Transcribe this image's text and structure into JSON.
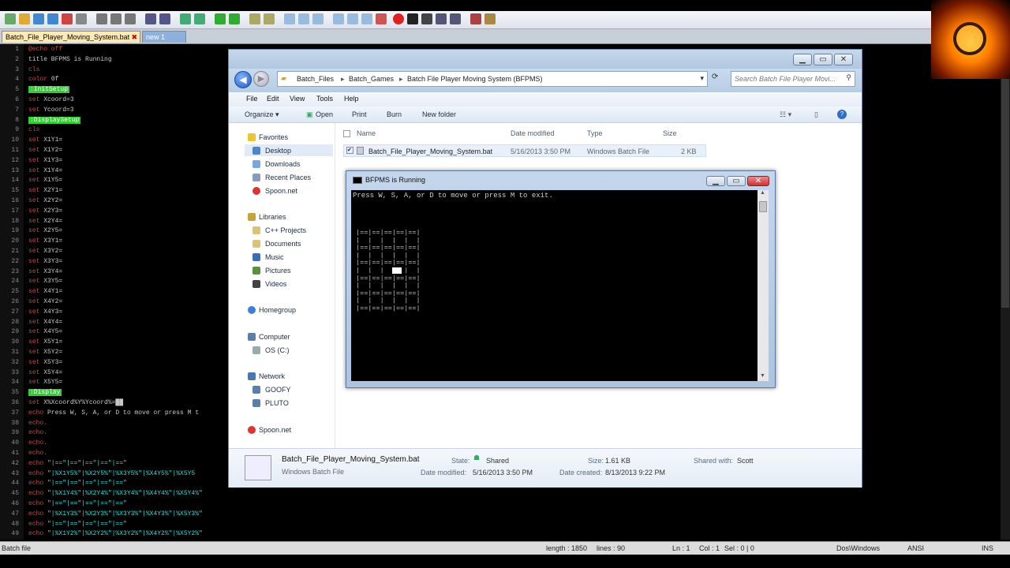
{
  "npp": {
    "tabs": [
      "Batch_File_Player_Moving_System.bat",
      "new 1"
    ],
    "lines": [
      {
        "n": "1",
        "parts": [
          [
            "kw",
            "@echo off"
          ]
        ]
      },
      {
        "n": "2",
        "parts": [
          [
            "",
            "title BFPMS is Running"
          ]
        ]
      },
      {
        "n": "3",
        "parts": [
          [
            "kw",
            "cls"
          ]
        ]
      },
      {
        "n": "4",
        "parts": [
          [
            "kw",
            "color"
          ],
          [
            "",
            " 0f"
          ]
        ]
      },
      {
        "n": "5",
        "parts": [
          [
            "lbl",
            ":InitSetup"
          ]
        ]
      },
      {
        "n": "6",
        "parts": [
          [
            "kw",
            "set"
          ],
          [
            "",
            " Xcoord=3"
          ]
        ]
      },
      {
        "n": "7",
        "parts": [
          [
            "kw",
            "set"
          ],
          [
            "",
            " Ycoord=3"
          ]
        ]
      },
      {
        "n": "8",
        "parts": [
          [
            "lbl",
            ":DisplaySetup"
          ]
        ]
      },
      {
        "n": "9",
        "parts": [
          [
            "kw",
            "cls"
          ]
        ]
      },
      {
        "n": "10",
        "parts": [
          [
            "kw",
            "set"
          ],
          [
            "",
            " X1Y1="
          ]
        ]
      },
      {
        "n": "11",
        "parts": [
          [
            "kw",
            "set"
          ],
          [
            "",
            " X1Y2="
          ]
        ]
      },
      {
        "n": "12",
        "parts": [
          [
            "kw",
            "set"
          ],
          [
            "",
            " X1Y3="
          ]
        ]
      },
      {
        "n": "13",
        "parts": [
          [
            "kw",
            "set"
          ],
          [
            "",
            " X1Y4="
          ]
        ]
      },
      {
        "n": "14",
        "parts": [
          [
            "kw",
            "set"
          ],
          [
            "",
            " X1Y5="
          ]
        ]
      },
      {
        "n": "15",
        "parts": [
          [
            "kw",
            "set"
          ],
          [
            "",
            " X2Y1="
          ]
        ]
      },
      {
        "n": "16",
        "parts": [
          [
            "kw",
            "set"
          ],
          [
            "",
            " X2Y2="
          ]
        ]
      },
      {
        "n": "17",
        "parts": [
          [
            "kw",
            "set"
          ],
          [
            "",
            " X2Y3="
          ]
        ]
      },
      {
        "n": "18",
        "parts": [
          [
            "kw",
            "set"
          ],
          [
            "",
            " X2Y4="
          ]
        ]
      },
      {
        "n": "19",
        "parts": [
          [
            "kw",
            "set"
          ],
          [
            "",
            " X2Y5="
          ]
        ]
      },
      {
        "n": "20",
        "parts": [
          [
            "kw",
            "set"
          ],
          [
            "",
            " X3Y1="
          ]
        ]
      },
      {
        "n": "21",
        "parts": [
          [
            "kw",
            "set"
          ],
          [
            "",
            " X3Y2="
          ]
        ]
      },
      {
        "n": "22",
        "parts": [
          [
            "kw",
            "set"
          ],
          [
            "",
            " X3Y3="
          ]
        ]
      },
      {
        "n": "23",
        "parts": [
          [
            "kw",
            "set"
          ],
          [
            "",
            " X3Y4="
          ]
        ]
      },
      {
        "n": "24",
        "parts": [
          [
            "kw",
            "set"
          ],
          [
            "",
            " X3Y5="
          ]
        ]
      },
      {
        "n": "25",
        "parts": [
          [
            "kw",
            "set"
          ],
          [
            "",
            " X4Y1="
          ]
        ]
      },
      {
        "n": "26",
        "parts": [
          [
            "kw",
            "set"
          ],
          [
            "",
            " X4Y2="
          ]
        ]
      },
      {
        "n": "27",
        "parts": [
          [
            "kw",
            "set"
          ],
          [
            "",
            " X4Y3="
          ]
        ]
      },
      {
        "n": "28",
        "parts": [
          [
            "kw",
            "set"
          ],
          [
            "",
            " X4Y4="
          ]
        ]
      },
      {
        "n": "29",
        "parts": [
          [
            "kw",
            "set"
          ],
          [
            "",
            " X4Y5="
          ]
        ]
      },
      {
        "n": "30",
        "parts": [
          [
            "kw",
            "set"
          ],
          [
            "",
            " X5Y1="
          ]
        ]
      },
      {
        "n": "31",
        "parts": [
          [
            "kw",
            "set"
          ],
          [
            "",
            " X5Y2="
          ]
        ]
      },
      {
        "n": "32",
        "parts": [
          [
            "kw",
            "set"
          ],
          [
            "",
            " X5Y3="
          ]
        ]
      },
      {
        "n": "33",
        "parts": [
          [
            "kw",
            "set"
          ],
          [
            "",
            " X5Y4="
          ]
        ]
      },
      {
        "n": "34",
        "parts": [
          [
            "kw",
            "set"
          ],
          [
            "",
            " X5Y5="
          ]
        ]
      },
      {
        "n": "35",
        "parts": [
          [
            "lbl",
            ":Display"
          ]
        ]
      },
      {
        "n": "36",
        "parts": [
          [
            "kw",
            "set"
          ],
          [
            "",
            " X%Xcoord%Y%Ycoord%=██"
          ]
        ]
      },
      {
        "n": "37",
        "parts": [
          [
            "kw",
            "echo"
          ],
          [
            "",
            " Press W, S, A, or D to move or press M t"
          ]
        ]
      },
      {
        "n": "38",
        "parts": [
          [
            "kw",
            "echo."
          ]
        ]
      },
      {
        "n": "39",
        "parts": [
          [
            "kw",
            "echo."
          ]
        ]
      },
      {
        "n": "40",
        "parts": [
          [
            "kw",
            "echo."
          ]
        ]
      },
      {
        "n": "41",
        "parts": [
          [
            "kw",
            "echo."
          ]
        ]
      },
      {
        "n": "42",
        "parts": [
          [
            "kw",
            "echo"
          ],
          [
            "cy",
            " \"|==\"|==\"|==\"|==\"|==\""
          ]
        ]
      },
      {
        "n": "43",
        "parts": [
          [
            "kw",
            "echo"
          ],
          [
            "cy",
            " \"|%X1Y5%\"|%X2Y5%\"|%X3Y5%\"|%X4Y5%\"|%X5Y5"
          ]
        ]
      },
      {
        "n": "44",
        "parts": [
          [
            "kw",
            "echo"
          ],
          [
            "cy",
            " \"|==\"|==\"|==\"|==\"|==\""
          ]
        ]
      },
      {
        "n": "45",
        "parts": [
          [
            "kw",
            "echo"
          ],
          [
            "cy",
            " \"|%X1Y4%\"|%X2Y4%\"|%X3Y4%\"|%X4Y4%\"|%X5Y4%\""
          ]
        ]
      },
      {
        "n": "46",
        "parts": [
          [
            "kw",
            "echo"
          ],
          [
            "cy",
            " \"|==\"|==\"|==\"|==\"|==\""
          ]
        ]
      },
      {
        "n": "47",
        "parts": [
          [
            "kw",
            "echo"
          ],
          [
            "cy",
            " \"|%X1Y3%\"|%X2Y3%\"|%X3Y3%\"|%X4Y3%\"|%X5Y3%\""
          ]
        ]
      },
      {
        "n": "48",
        "parts": [
          [
            "kw",
            "echo"
          ],
          [
            "cy",
            " \"|==\"|==\"|==\"|==\"|==\""
          ]
        ]
      },
      {
        "n": "49",
        "parts": [
          [
            "kw",
            "echo"
          ],
          [
            "cy",
            " \"|%X1Y2%\"|%X2Y2%\"|%X3Y2%\"|%X4Y2%\"|%X5Y2%\""
          ]
        ]
      }
    ],
    "status": {
      "type": "Batch file",
      "length": "length : 1850",
      "lines": "lines : 90",
      "ln": "Ln : 1",
      "col": "Col : 1",
      "sel": "Sel : 0 | 0",
      "eol": "Dos\\Windows",
      "enc": "ANSI",
      "mode": "INS"
    }
  },
  "explorer": {
    "breadcrumb": [
      "Batch_Files",
      "Batch_Games",
      "Batch File Player Moving System (BFPMS)"
    ],
    "search_placeholder": "Search Batch File Player Movi...",
    "menu": [
      "File",
      "Edit",
      "View",
      "Tools",
      "Help"
    ],
    "commands": [
      "Organize ▾",
      "Open",
      "Print",
      "Burn",
      "New folder"
    ],
    "nav": {
      "favorites": "Favorites",
      "fav_items": [
        "Desktop",
        "Downloads",
        "Recent Places",
        "Spoon.net"
      ],
      "libraries": "Libraries",
      "lib_items": [
        "C++ Projects",
        "Documents",
        "Music",
        "Pictures",
        "Videos"
      ],
      "homegroup": "Homegroup",
      "computer": "Computer",
      "comp_items": [
        "OS (C:)"
      ],
      "network": "Network",
      "net_items": [
        "GOOFY",
        "PLUTO"
      ],
      "spoon": "Spoon.net"
    },
    "columns": [
      "Name",
      "Date modified",
      "Type",
      "Size"
    ],
    "file": {
      "name": "Batch_File_Player_Moving_System.bat",
      "date": "5/16/2013 3:50 PM",
      "type": "Windows Batch File",
      "size": "2 KB"
    },
    "details": {
      "name": "Batch_File_Player_Moving_System.bat",
      "kind": "Windows Batch File",
      "state_label": "State:",
      "state_value": "Shared",
      "size_label": "Size:",
      "size_value": "1.61 KB",
      "shared_label": "Shared with:",
      "shared_value": "Scott",
      "modified_label": "Date modified:",
      "modified_value": "5/16/2013 3:50 PM",
      "created_label": "Date created:",
      "created_value": "8/13/2013 9:22 PM"
    }
  },
  "console": {
    "title": "BFPMS is Running",
    "prompt": "Press W, S, A, or D to move or press M to exit.",
    "grid": "|==|==|==|==|==|\n|  |  |  |  |  |\n|==|==|==|==|==|\n|  |  |  |  |  |\n|==|==|==|==|==|\n|  |  |  |  |  |\n|==|==|==|==|==|\n|  |  |  |  |  |\n|==|==|==|==|==|\n|  |  |  |  |  |\n|==|==|==|==|==|"
  }
}
